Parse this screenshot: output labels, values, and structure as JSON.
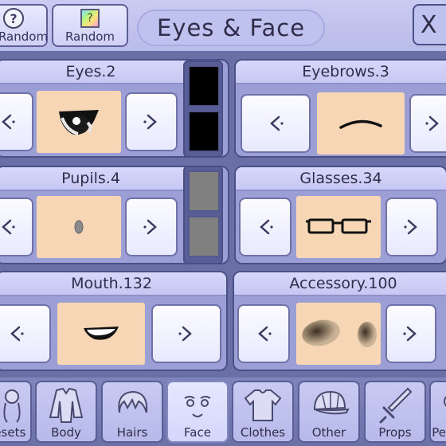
{
  "top": {
    "random_left_label": "Random",
    "random_left_icon": "question-circle-icon",
    "random_right_label": "Random",
    "random_right_icon": "question-square-icon",
    "title": "Eyes & Face",
    "close_glyph": "X"
  },
  "cards": [
    {
      "key": "eyes",
      "title": "Eyes.2"
    },
    {
      "key": "eyebrows",
      "title": "Eyebrows.3"
    },
    {
      "key": "pupils",
      "title": "Pupils.4"
    },
    {
      "key": "glasses",
      "title": "Glasses.34"
    },
    {
      "key": "mouth",
      "title": "Mouth.132"
    },
    {
      "key": "accessory",
      "title": "Accessory.100"
    }
  ],
  "swatches": {
    "eyes": [
      "#000000",
      "#000000"
    ],
    "pupils": [
      "#808080",
      "#808080"
    ]
  },
  "tabs": [
    {
      "label": "Presets",
      "icon": "person-icon"
    },
    {
      "label": "Body",
      "icon": "shirt-body-icon"
    },
    {
      "label": "Hairs",
      "icon": "hair-icon"
    },
    {
      "label": "Face",
      "icon": "face-icon"
    },
    {
      "label": "Clothes",
      "icon": "tshirt-icon"
    },
    {
      "label": "Other",
      "icon": "cap-icon"
    },
    {
      "label": "Props",
      "icon": "sword-icon"
    },
    {
      "label": "Pets",
      "icon": "pet-icon"
    }
  ],
  "active_tab": "Face",
  "colors": {
    "skin": "#f6d6b4",
    "panel": "#9b9fd6",
    "header": "#c6c8f3"
  }
}
